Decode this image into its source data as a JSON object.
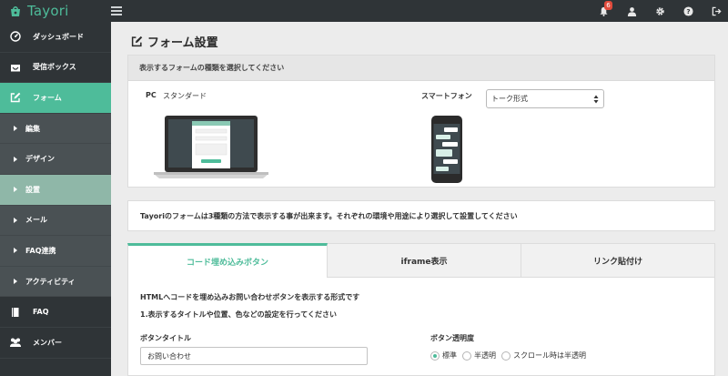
{
  "app": {
    "name": "Tayori"
  },
  "topbar": {
    "notification_count": "6"
  },
  "sidebar": {
    "items": [
      {
        "label": "ダッシュボード",
        "icon": "dashboard-icon"
      },
      {
        "label": "受信ボックス",
        "icon": "inbox-icon"
      },
      {
        "label": "フォーム",
        "icon": "form-edit-icon",
        "active": true
      }
    ],
    "sub_items": [
      {
        "label": "編集"
      },
      {
        "label": "デザイン"
      },
      {
        "label": "設置",
        "active": true
      },
      {
        "label": "メール"
      },
      {
        "label": "FAQ連携"
      },
      {
        "label": "アクティビティ"
      }
    ],
    "bottom_items": [
      {
        "label": "FAQ",
        "icon": "faq-book-icon"
      },
      {
        "label": "メンバー",
        "icon": "members-icon"
      }
    ]
  },
  "page": {
    "title": "フォーム設置"
  },
  "form_type": {
    "heading": "表示するフォームの種類を選択してください",
    "pc_label": "PC",
    "pc_value": "スタンダード",
    "smartphone_label": "スマートフォン",
    "smartphone_value": "トーク形式"
  },
  "info": {
    "text": "Tayoriのフォームは3種類の方法で表示する事が出来ます。それぞれの環境や用途により選択して設置してください"
  },
  "tabs": [
    {
      "label": "コード埋め込みボタン",
      "active": true
    },
    {
      "label": "iframe表示"
    },
    {
      "label": "リンク貼付け"
    }
  ],
  "panel": {
    "desc1": "HTMLへコードを埋め込みお問い合わせボタンを表示する形式です",
    "desc2": "1.表示するタイトルや位置、色などの設定を行ってください",
    "button_title_label": "ボタンタイトル",
    "button_title_value": "お問い合わせ",
    "opacity_label": "ボタン透明度",
    "opacity_options": [
      "標準",
      "半透明",
      "スクロール時は半透明"
    ],
    "opacity_selected": 0
  },
  "colors": {
    "accent": "#4ebc9a",
    "sidebar": "#2f3437",
    "badge": "#e04b3c"
  }
}
